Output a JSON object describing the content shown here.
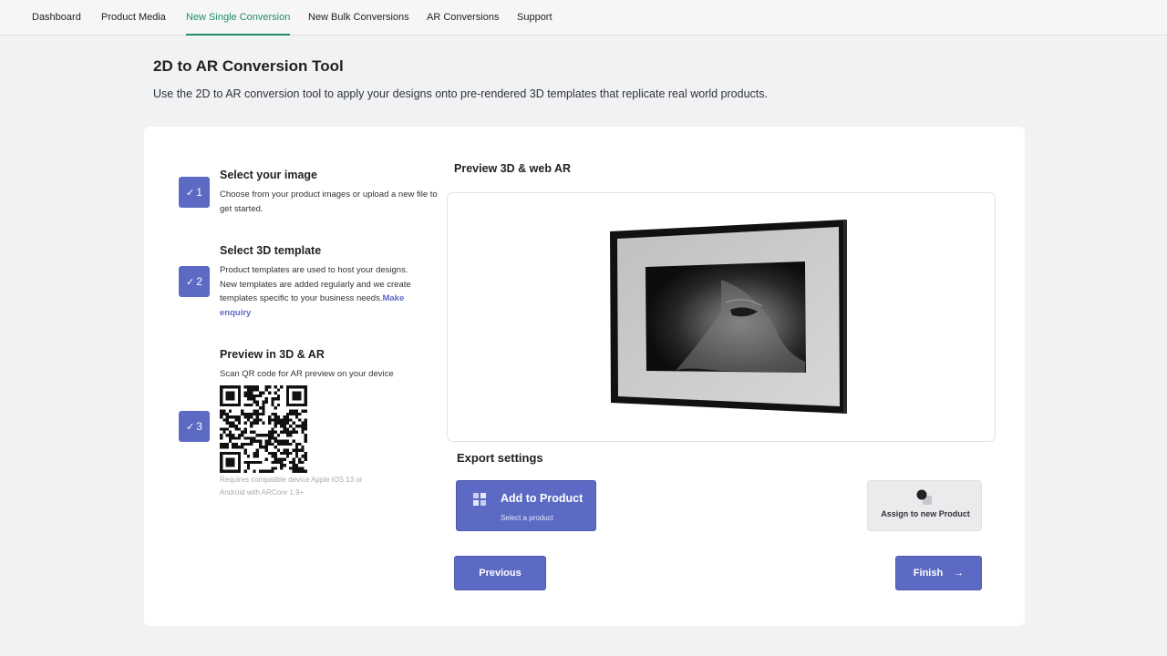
{
  "nav": {
    "tabs": [
      {
        "label": "Dashboard",
        "active": false
      },
      {
        "label": "Product Media",
        "active": false
      },
      {
        "label": "New Single Conversion",
        "active": true
      },
      {
        "label": "New Bulk Conversions",
        "active": false
      },
      {
        "label": "AR Conversions",
        "active": false
      },
      {
        "label": "Support",
        "active": false
      }
    ]
  },
  "page": {
    "title": "2D to AR Conversion Tool",
    "description": "Use the 2D to AR conversion tool to apply your designs onto pre-rendered 3D templates that replicate real world products."
  },
  "steps": [
    {
      "number": "1",
      "title": "Select your image",
      "text": "Choose from your product images or upload a new file to get started."
    },
    {
      "number": "2",
      "title": "Select 3D template",
      "text": "Product templates are used to host your designs. New templates are added regularly and we create templates specific to your business needs.",
      "link": "Make enquiry"
    },
    {
      "number": "3",
      "title": "Preview in 3D & AR",
      "text": "Scan QR code for AR preview on your device",
      "note": "Requires compatible device Apple iOS 13 or Android with ARCore 1.9+"
    }
  ],
  "preview": {
    "title": "Preview 3D & web AR"
  },
  "export": {
    "title": "Export settings",
    "add_to_product": {
      "label": "Add to Product",
      "sub": "Select a product"
    },
    "assign_new": {
      "label": "Assign to new Product"
    }
  },
  "actions": {
    "previous": "Previous",
    "finish": "Finish"
  },
  "colors": {
    "accent": "#5c6ac4",
    "active_tab": "#1f8f63",
    "background": "#f1f2f4"
  },
  "icons": {
    "step_check": "check-icon",
    "add_to_product": "grid-icon",
    "assign_new": "product-shapes-icon",
    "finish": "arrow-right-icon"
  }
}
